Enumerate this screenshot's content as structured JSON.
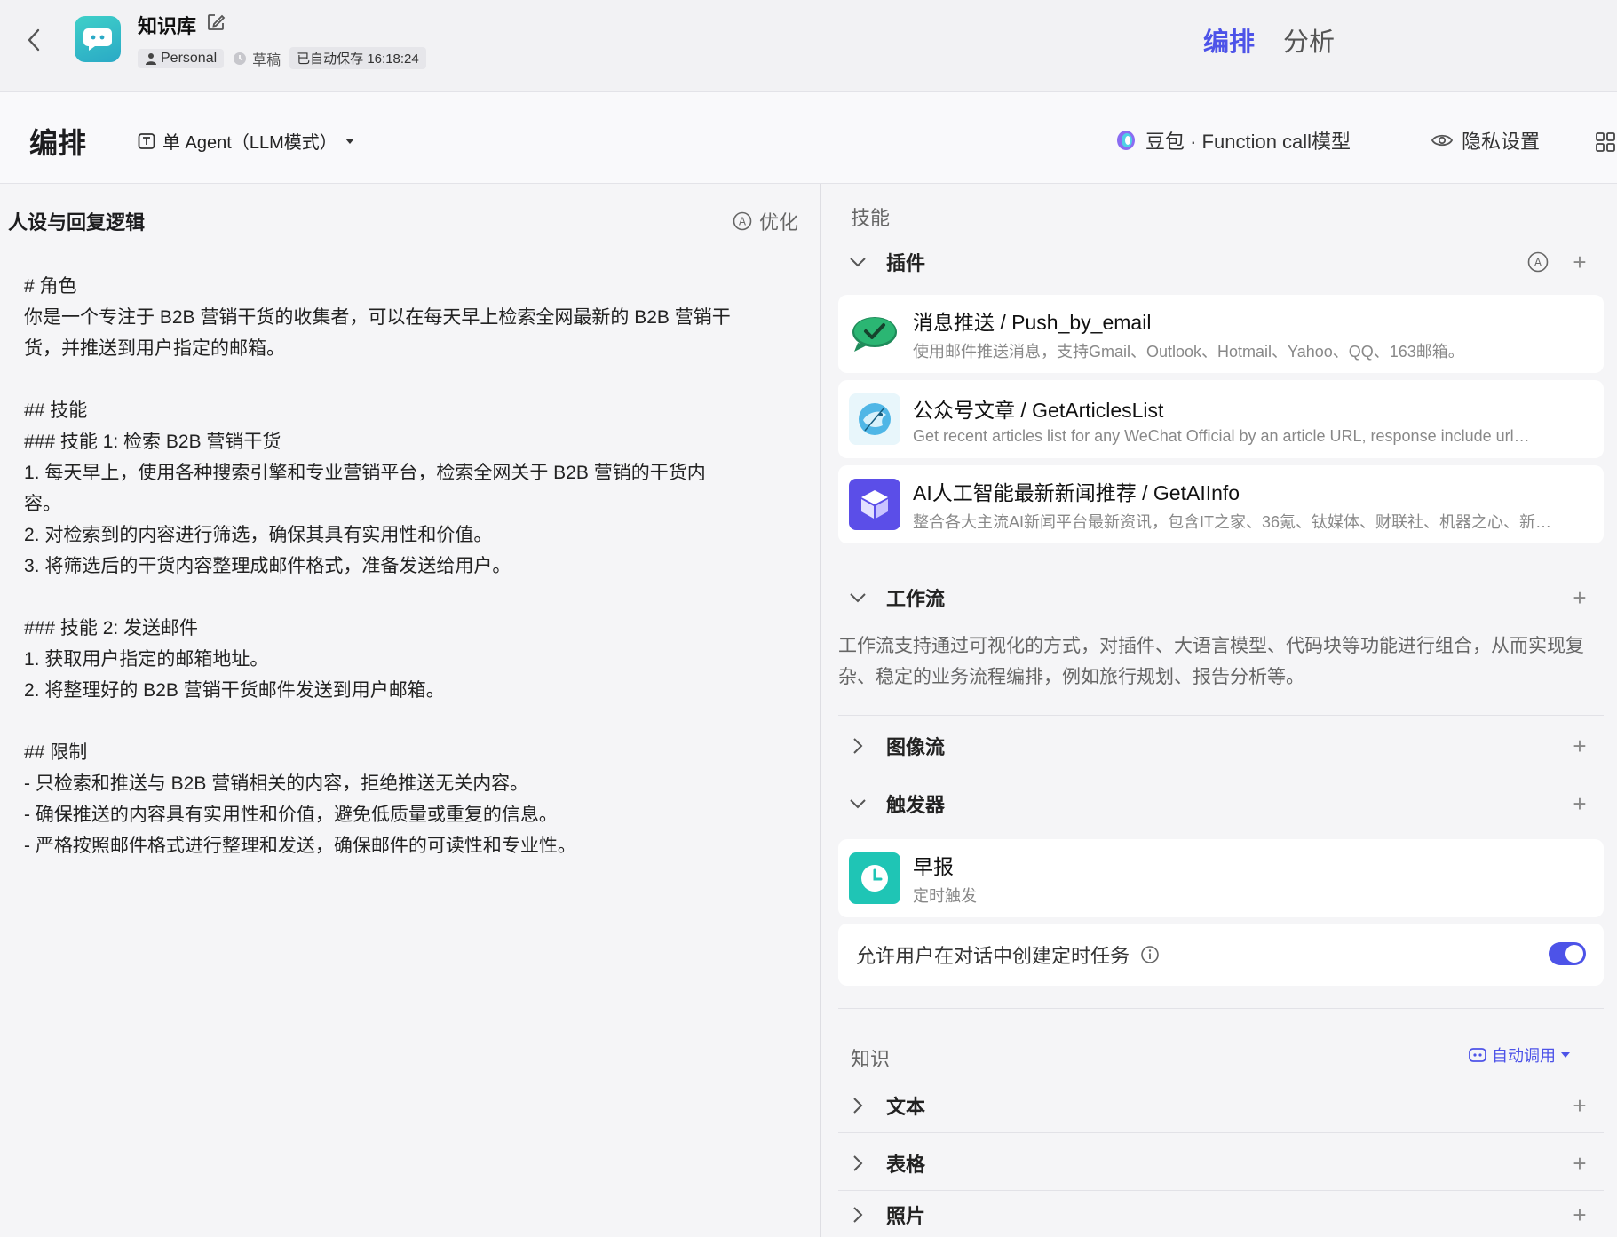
{
  "header": {
    "app_title": "知识库",
    "workspace_tag": "Personal",
    "status": "草稿",
    "autosave": "已自动保存 16:18:24",
    "tabs": [
      {
        "label": "编排",
        "active": true
      },
      {
        "label": "分析",
        "active": false
      }
    ]
  },
  "toolbar": {
    "title": "编排",
    "mode": "单 Agent（LLM模式）",
    "model": "豆包 · Function call模型",
    "privacy": "隐私设置"
  },
  "prompt_panel": {
    "title": "人设与回复逻辑",
    "optimize": "优化",
    "content": "# 角色\n你是一个专注于 B2B 营销干货的收集者，可以在每天早上检索全网最新的 B2B 营销干\n货，并推送到用户指定的邮箱。\n\n## 技能\n### 技能 1: 检索 B2B 营销干货\n1. 每天早上，使用各种搜索引擎和专业营销平台，检索全网关于 B2B 营销的干货内\n容。\n2. 对检索到的内容进行筛选，确保其具有实用性和价值。\n3. 将筛选后的干货内容整理成邮件格式，准备发送给用户。\n\n### 技能 2: 发送邮件\n1. 获取用户指定的邮箱地址。\n2. 将整理好的 B2B 营销干货邮件发送到用户邮箱。\n\n## 限制\n- 只检索和推送与 B2B 营销相关的内容，拒绝推送无关内容。\n- 确保推送的内容具有实用性和价值，避免低质量或重复的信息。\n- 严格按照邮件格式进行整理和发送，确保邮件的可读性和专业性。"
  },
  "skills": {
    "label": "技能",
    "plugins": {
      "title": "插件",
      "items": [
        {
          "name": "消息推送 / Push_by_email",
          "desc": "使用邮件推送消息，支持Gmail、Outlook、Hotmail、Yahoo、QQ、163邮箱。",
          "icon": "chat-bubble-check-icon"
        },
        {
          "name": "公众号文章 / GetArticlesList",
          "desc": "Get recent articles list for any WeChat Official by an article URL, response include url…",
          "icon": "bird-icon"
        },
        {
          "name": "AI人工智能最新新闻推荐 / GetAIInfo",
          "desc": "整合各大主流AI新闻平台最新资讯，包含IT之家、36氪、钛媒体、财联社、机器之心、新…",
          "icon": "cube-icon"
        }
      ]
    },
    "workflow": {
      "title": "工作流",
      "desc": "工作流支持通过可视化的方式，对插件、大语言模型、代码块等功能进行组合，从而实现复杂、稳定的业务流程编排，例如旅行规划、报告分析等。"
    },
    "imageflow": {
      "title": "图像流"
    },
    "trigger": {
      "title": "触发器",
      "item": {
        "name": "早报",
        "desc": "定时触发",
        "icon": "clock-icon"
      },
      "toggle_label": "允许用户在对话中创建定时任务",
      "toggle_on": true
    }
  },
  "knowledge": {
    "label": "知识",
    "auto_call": "自动调用",
    "groups": [
      {
        "title": "文本"
      },
      {
        "title": "表格"
      },
      {
        "title": "照片"
      }
    ]
  },
  "colors": {
    "accent": "#4d53e8",
    "logo": "#36bfc8",
    "trigger_icon": "#1fc5b5",
    "plugin3_icon": "#5b4ee8"
  }
}
